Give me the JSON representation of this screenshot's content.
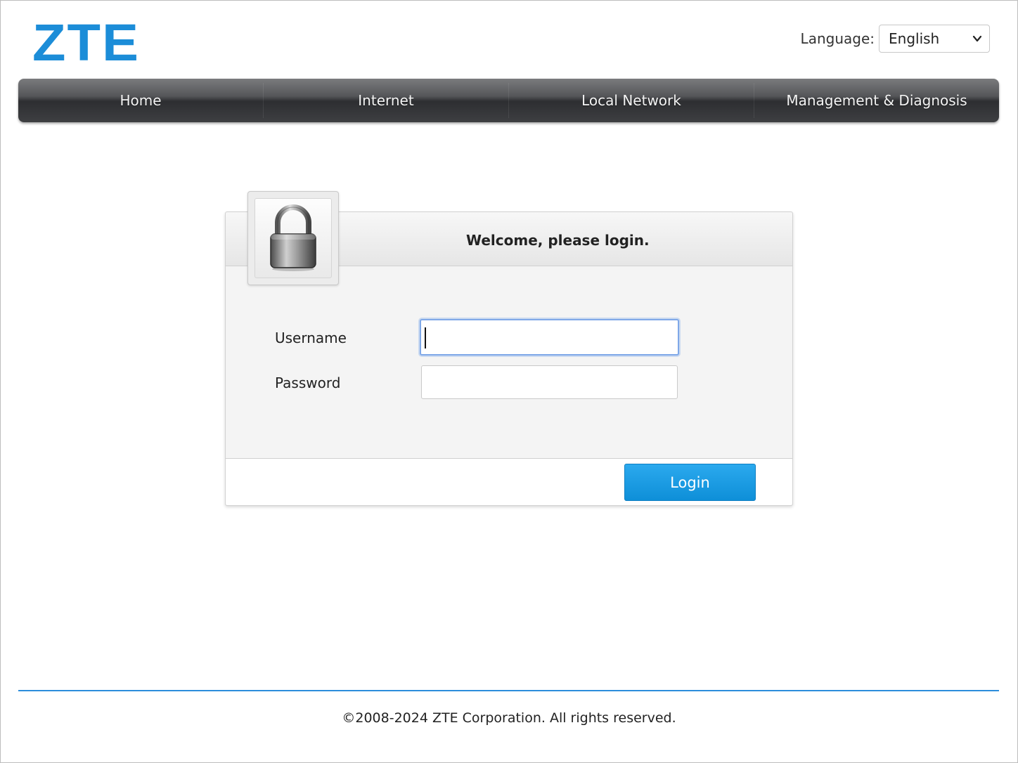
{
  "brand": {
    "logo_text": "ZTE",
    "color": "#1c8dd8"
  },
  "language": {
    "label": "Language:",
    "selected": "English"
  },
  "nav": {
    "items": [
      {
        "label": "Home"
      },
      {
        "label": "Internet"
      },
      {
        "label": "Local Network"
      },
      {
        "label": "Management & Diagnosis"
      }
    ]
  },
  "login": {
    "title": "Welcome, please login.",
    "username_label": "Username",
    "username_value": "",
    "password_label": "Password",
    "password_value": "",
    "button_label": "Login",
    "icon": "lock-icon",
    "button_color": "#1a9be3"
  },
  "footer": {
    "copyright": "©2008-2024 ZTE Corporation. All rights reserved.",
    "rule_color": "#2c8ddb"
  }
}
